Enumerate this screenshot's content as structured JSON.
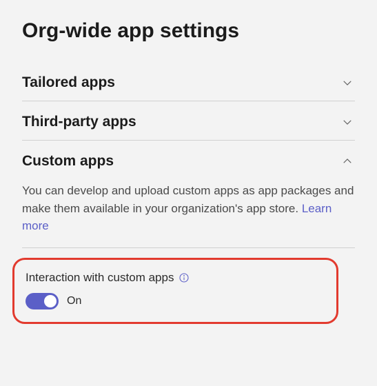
{
  "page": {
    "title": "Org-wide app settings"
  },
  "sections": {
    "tailored": {
      "title": "Tailored apps",
      "expanded": false
    },
    "thirdparty": {
      "title": "Third-party apps",
      "expanded": false
    },
    "custom": {
      "title": "Custom apps",
      "expanded": true,
      "description": "You can develop and upload custom apps as app packages and make them available in your organization's app store. ",
      "learn_more": "Learn more",
      "setting": {
        "label": "Interaction with custom apps",
        "state_label": "On",
        "on": true
      }
    }
  }
}
